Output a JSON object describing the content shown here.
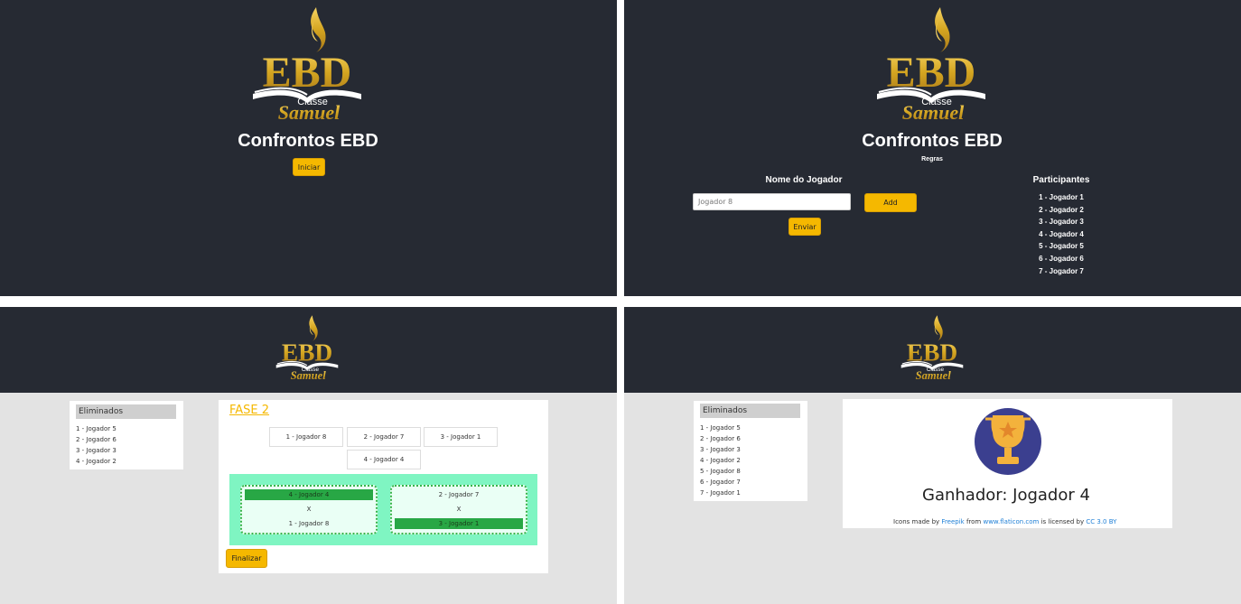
{
  "logo": {
    "big": "EBD",
    "small": "Classe",
    "script": "Samuel"
  },
  "screen1": {
    "title": "Confrontos EBD",
    "start_button": "Iniciar"
  },
  "screen2": {
    "title": "Confrontos EBD",
    "rules_link": "Regras",
    "player_name_label": "Nome do Jogador",
    "player_input_value": "Jogador 8",
    "add_button": "Add",
    "send_button": "Enviar",
    "participants_title": "Participantes",
    "participants": [
      "1 - Jogador 1",
      "2 - Jogador 2",
      "3 - Jogador 3",
      "4 - Jogador 4",
      "5 - Jogador 5",
      "6 - Jogador 6",
      "7 - Jogador 7"
    ]
  },
  "screen3": {
    "eliminated_title": "Eliminados",
    "eliminated": [
      "1 - Jogador 5",
      "2 - Jogador 6",
      "3 - Jogador 3",
      "4 - Jogador 2"
    ],
    "phase_title": "FASE 2",
    "players": [
      "1 - Jogador 8",
      "2 - Jogador 7",
      "3 - Jogador 1",
      "4 - Jogador 4"
    ],
    "matches": [
      {
        "top": "4 - Jogador 4",
        "vs": "X",
        "bottom": "1 - Jogador 8",
        "winner": "top"
      },
      {
        "top": "2 - Jogador 7",
        "vs": "X",
        "bottom": "3 - Jogador 1",
        "winner": "bottom"
      }
    ],
    "finish_button": "Finalizar"
  },
  "screen4": {
    "eliminated_title": "Eliminados",
    "eliminated": [
      "1 - Jogador 5",
      "2 - Jogador 6",
      "3 - Jogador 3",
      "4 - Jogador 2",
      "5 - Jogador 8",
      "6 - Jogador 7",
      "7 - Jogador 1"
    ],
    "winner_text": "Ganhador: Jogador 4",
    "credits": {
      "prefix": "Icons made by",
      "author": "Freepik",
      "from": "from",
      "site": "www.flaticon.com",
      "licensed": "is licensed by",
      "license": "CC 3.0 BY"
    }
  },
  "colors": {
    "dark_bg": "#262a33",
    "accent_yellow": "#f5b800",
    "match_bg": "#7ff5c2",
    "winner_green": "#28a745",
    "gray_bg": "#e3e3e3"
  }
}
